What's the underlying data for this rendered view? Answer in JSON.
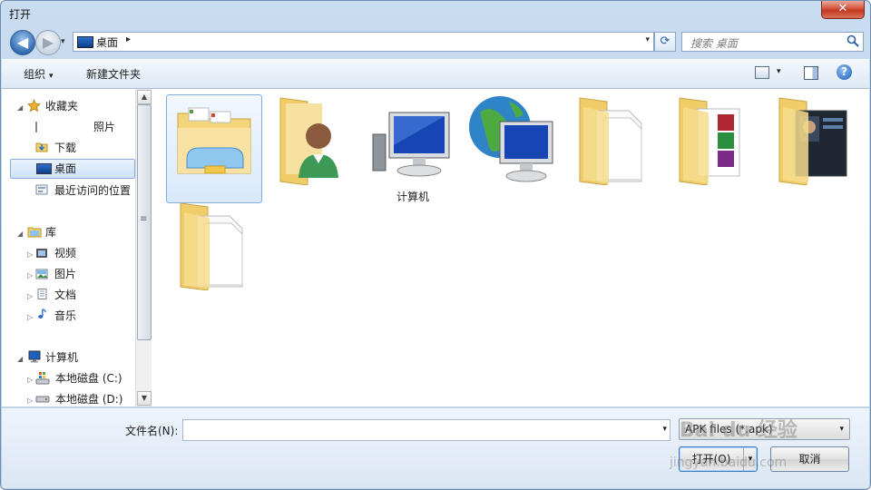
{
  "window": {
    "title": "打开",
    "close_glyph": "✕"
  },
  "navigation": {
    "back_glyph": "◀",
    "forward_glyph": "▶",
    "history_glyph": "▾",
    "address_path": "桌面",
    "address_separator": "▸",
    "address_dropdown_glyph": "▾",
    "refresh_glyph": "⟳",
    "search_placeholder": "搜索 桌面"
  },
  "toolbar": {
    "organize_label": "组织",
    "organize_arrow": "▾",
    "new_folder_label": "新建文件夹",
    "view_dropdown_glyph": "▾",
    "help_glyph": "?"
  },
  "sidebar": {
    "favorites_label": "收藏夹",
    "favorites": [
      {
        "label": "照片",
        "icon": "folder-icon"
      },
      {
        "label": "下载",
        "icon": "download-folder-icon"
      },
      {
        "label": "桌面",
        "icon": "desktop-icon",
        "selected": true
      },
      {
        "label": "最近访问的位置",
        "icon": "recent-places-icon"
      }
    ],
    "libraries_label": "库",
    "libraries": [
      {
        "label": "视频",
        "icon": "video-library-icon"
      },
      {
        "label": "图片",
        "icon": "picture-library-icon"
      },
      {
        "label": "文档",
        "icon": "document-library-icon"
      },
      {
        "label": "音乐",
        "icon": "music-library-icon"
      }
    ],
    "computer_label": "计算机",
    "drives": [
      {
        "label": "本地磁盘 (C:)",
        "icon": "system-drive-icon"
      },
      {
        "label": "本地磁盘 (D:)",
        "icon": "drive-icon"
      }
    ],
    "tree_expanded_glyph": "◢",
    "tree_collapsed_glyph": "▷"
  },
  "scrollbar": {
    "up_glyph": "▲",
    "down_glyph": "▼",
    "grip_glyph": "≡"
  },
  "files": [
    {
      "label": "",
      "icon": "libraries-folder-icon",
      "selected": true
    },
    {
      "label": "",
      "icon": "user-folder-icon"
    },
    {
      "label": "计算机",
      "icon": "computer-icon"
    },
    {
      "label": "",
      "icon": "network-icon"
    },
    {
      "label": "",
      "icon": "documents-folder-icon"
    },
    {
      "label": "",
      "icon": "media-folder-icon"
    },
    {
      "label": "",
      "icon": "screenshots-folder-icon"
    },
    {
      "label": "",
      "icon": "documents-folder-icon"
    }
  ],
  "bottom": {
    "filename_label": "文件名(N):",
    "filename_value": "",
    "filename_dropdown_glyph": "▾",
    "filter_value": "APK files (*.apk)",
    "filter_dropdown_glyph": "▾",
    "open_label": "打开(O)",
    "open_split_glyph": "▾",
    "cancel_label": "取消"
  },
  "watermark": {
    "text": "Bai du 经验",
    "sub": "jingyan.baidu.com"
  }
}
